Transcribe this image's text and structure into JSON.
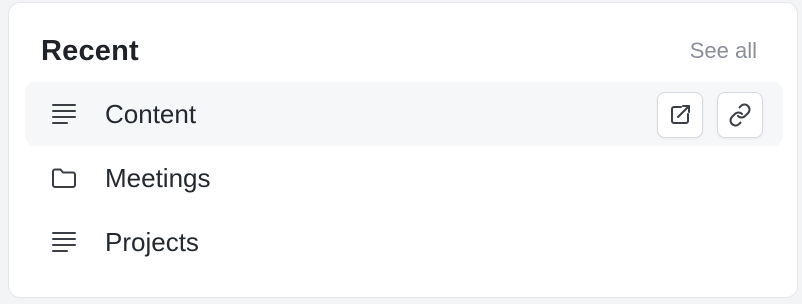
{
  "header": {
    "title": "Recent",
    "see_all_label": "See all"
  },
  "items": [
    {
      "label": "Content",
      "icon": "document-lines-icon",
      "hovered": true
    },
    {
      "label": "Meetings",
      "icon": "folder-icon",
      "hovered": false
    },
    {
      "label": "Projects",
      "icon": "document-lines-icon",
      "hovered": false
    }
  ],
  "row_actions": [
    {
      "icon": "open-external-icon"
    },
    {
      "icon": "copy-link-icon"
    }
  ],
  "colors": {
    "text": "#24292f",
    "muted": "#8a8f98",
    "hover_row": "#f6f7f9",
    "border": "#e5e7eb"
  }
}
